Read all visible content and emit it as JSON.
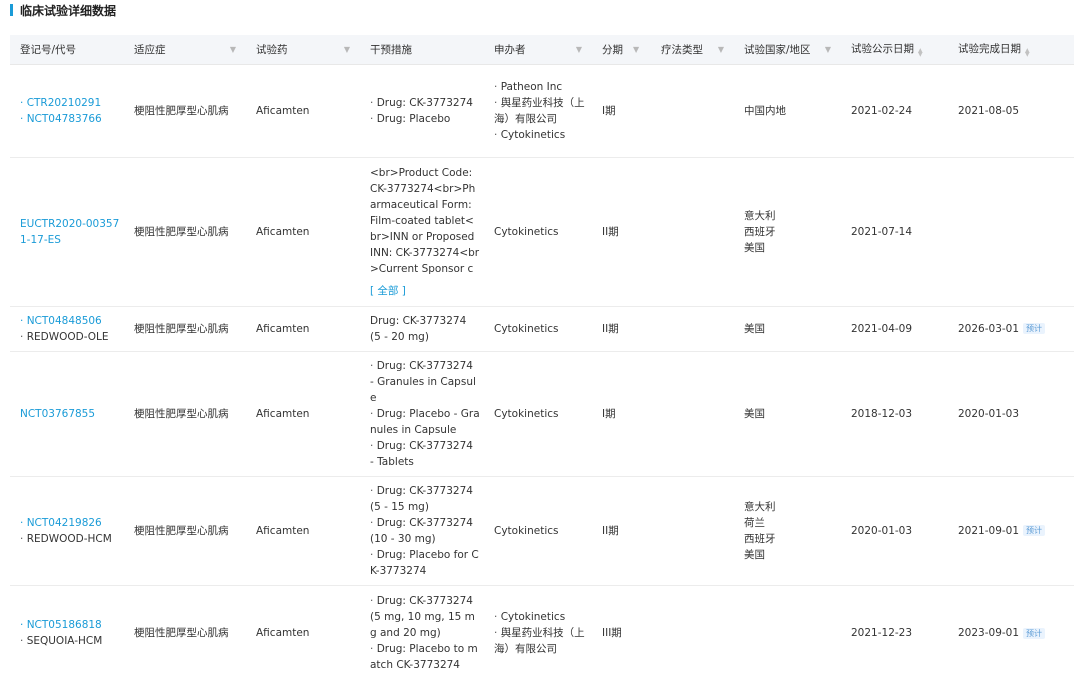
{
  "section_title": "临床试验详细数据",
  "headers": {
    "reg": "登记号/代号",
    "indication": "适应症",
    "drug": "试验药",
    "intervention": "干预措施",
    "sponsor": "申办者",
    "phase": "分期",
    "therapy": "疗法类型",
    "country": "试验国家/地区",
    "pub_date": "试验公示日期",
    "end_date": "试验完成日期"
  },
  "expand_label": "[ 全部 ]",
  "est_label": "预计",
  "rows": [
    {
      "reg": [
        "CTR20210291",
        "NCT04783766"
      ],
      "indication": "梗阻性肥厚型心肌病",
      "drug": "Aficamten",
      "intervention": [
        "Drug: CK-3773274",
        "Drug: Placebo"
      ],
      "sponsor": [
        "Patheon Inc",
        "舆星药业科技（上海）有限公司",
        "Cytokinetics"
      ],
      "phase": "I期",
      "country": [
        "中国内地"
      ],
      "pub_date": "2021-02-24",
      "end_date": "2021-08-05"
    },
    {
      "reg_plain": "EUCTR2020-003571-17-ES",
      "indication": "梗阻性肥厚型心肌病",
      "drug": "Aficamten",
      "intervention_text": "<br>Product Code: CK-3773274<br>Pharmaceutical Form: Film-coated tablet<br>INN or Proposed INN: CK-3773274<br>Current Sponsor c",
      "sponsor_plain": "Cytokinetics",
      "phase": "II期",
      "country": [
        "意大利",
        "西班牙",
        "美国"
      ],
      "pub_date": "2021-07-14",
      "end_date": ""
    },
    {
      "reg": [
        "NCT04848506"
      ],
      "reg_alias": "REDWOOD-OLE",
      "indication": "梗阻性肥厚型心肌病",
      "drug": "Aficamten",
      "intervention_text": "Drug: CK-3773274 (5 - 20 mg)",
      "sponsor_plain": "Cytokinetics",
      "phase": "II期",
      "country": [
        "美国"
      ],
      "pub_date": "2021-04-09",
      "end_date": "2026-03-01",
      "estimated": true
    },
    {
      "reg_plain": "NCT03767855",
      "indication": "梗阻性肥厚型心肌病",
      "drug": "Aficamten",
      "intervention": [
        "Drug: CK-3773274 - Granules in Capsule",
        "Drug: Placebo - Granules in Capsule",
        "Drug: CK-3773274 - Tablets"
      ],
      "sponsor_plain": "Cytokinetics",
      "phase": "I期",
      "country": [
        "美国"
      ],
      "pub_date": "2018-12-03",
      "end_date": "2020-01-03"
    },
    {
      "reg": [
        "NCT04219826"
      ],
      "reg_alias": "REDWOOD-HCM",
      "indication": "梗阻性肥厚型心肌病",
      "drug": "Aficamten",
      "intervention": [
        "Drug: CK-3773274 (5 - 15 mg)",
        "Drug: CK-3773274 (10 - 30 mg)",
        "Drug: Placebo for CK-3773274"
      ],
      "sponsor_plain": "Cytokinetics",
      "phase": "II期",
      "country": [
        "意大利",
        "荷兰",
        "西班牙",
        "美国"
      ],
      "pub_date": "2020-01-03",
      "end_date": "2021-09-01",
      "estimated": true
    },
    {
      "reg": [
        "NCT05186818"
      ],
      "reg_alias": "SEQUOIA-HCM",
      "indication": "梗阻性肥厚型心肌病",
      "drug": "Aficamten",
      "intervention": [
        "Drug: CK-3773274 (5 mg, 10 mg, 15 mg and 20 mg)",
        "Drug: Placebo to match CK-3773274"
      ],
      "sponsor": [
        "Cytokinetics",
        "舆星药业科技（上海）有限公司"
      ],
      "phase": "III期",
      "country": [],
      "pub_date": "2021-12-23",
      "end_date": "2023-09-01",
      "estimated": true
    }
  ]
}
